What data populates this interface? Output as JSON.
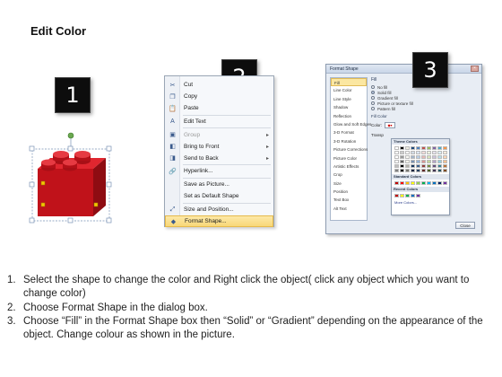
{
  "title": "Edit Color",
  "badges": [
    "1",
    "2",
    "3"
  ],
  "context_menu": {
    "items": [
      {
        "label": "Cut",
        "icon": "scissors-icon",
        "glyph": "✂",
        "disabled": false,
        "submenu": false
      },
      {
        "label": "Copy",
        "icon": "copy-icon",
        "glyph": "❐",
        "disabled": false,
        "submenu": false
      },
      {
        "label": "Paste",
        "icon": "paste-icon",
        "glyph": "📋",
        "disabled": false,
        "submenu": false
      },
      {
        "label": "Edit Text",
        "icon": "edit-text-icon",
        "glyph": "A",
        "disabled": false,
        "submenu": false
      },
      {
        "label": "Group",
        "icon": "group-icon",
        "glyph": "▣",
        "disabled": true,
        "submenu": true
      },
      {
        "label": "Bring to Front",
        "icon": "bring-to-front-icon",
        "glyph": "◧",
        "disabled": false,
        "submenu": true
      },
      {
        "label": "Send to Back",
        "icon": "send-to-back-icon",
        "glyph": "◨",
        "disabled": false,
        "submenu": true
      },
      {
        "label": "Hyperlink...",
        "icon": "hyperlink-icon",
        "glyph": "🔗",
        "disabled": false,
        "submenu": false
      },
      {
        "label": "Save as Picture...",
        "icon": "",
        "glyph": "",
        "disabled": false,
        "submenu": false
      },
      {
        "label": "Set as Default Shape",
        "icon": "",
        "glyph": "",
        "disabled": false,
        "submenu": false
      },
      {
        "label": "Size and Position...",
        "icon": "size-position-icon",
        "glyph": "⤢",
        "disabled": false,
        "submenu": false
      },
      {
        "label": "Format Shape...",
        "icon": "format-shape-icon",
        "glyph": "◆",
        "disabled": false,
        "submenu": false,
        "highlighted": true
      }
    ]
  },
  "dialog": {
    "title": "Format Shape",
    "categories": [
      "Fill",
      "Line Color",
      "Line Style",
      "Shadow",
      "Reflection",
      "Glow and Soft Edges",
      "3-D Format",
      "3-D Rotation",
      "Picture Corrections",
      "Picture Color",
      "Artistic Effects",
      "Crop",
      "Size",
      "Position",
      "Text Box",
      "Alt Text"
    ],
    "selected_category": "Fill",
    "fill_heading": "Fill",
    "fill_options": [
      {
        "label": "No fill",
        "selected": false
      },
      {
        "label": "Solid fill",
        "selected": true
      },
      {
        "label": "Gradient fill",
        "selected": false
      },
      {
        "label": "Picture or texture fill",
        "selected": false
      },
      {
        "label": "Pattern fill",
        "selected": false
      }
    ],
    "fill_color_heading": "Fill Color",
    "color_label": "Color:",
    "transparency_label": "Transp",
    "palette": {
      "theme_colors_label": "Theme Colors",
      "standard_colors_label": "Standard Colors",
      "recent_colors_label": "Recent Colors",
      "more_colors_label": "More Colors...",
      "theme_top": [
        "#ffffff",
        "#000000",
        "#eeece1",
        "#1f497d",
        "#4f81bd",
        "#c0504d",
        "#9bbb59",
        "#8064a2",
        "#4bacc6",
        "#f79646"
      ],
      "standard": [
        "#c00000",
        "#ff0000",
        "#ffc000",
        "#ffff00",
        "#92d050",
        "#00b050",
        "#00b0f0",
        "#0070c0",
        "#002060",
        "#7030a0"
      ],
      "recent": [
        "#c00000",
        "#ffff00",
        "#00b050",
        "#0070c0",
        "#7030a0"
      ]
    },
    "close_label": "Close"
  },
  "instructions": [
    {
      "num": "1.",
      "text": "Select the shape to change the color and Right click the object( click any object which you want to change color)"
    },
    {
      "num": "2.",
      "text": "Choose Format Shape in the dialog box."
    },
    {
      "num": "3.",
      "text": "Choose “Fill” in the Format Shape box then “Solid” or “Gradient” depending on the appearance of the object. Change colour as shown in the picture."
    }
  ],
  "colors": {
    "brick": "#c0121a",
    "handle": "#6aa84f",
    "highlight": "#f8d777"
  }
}
